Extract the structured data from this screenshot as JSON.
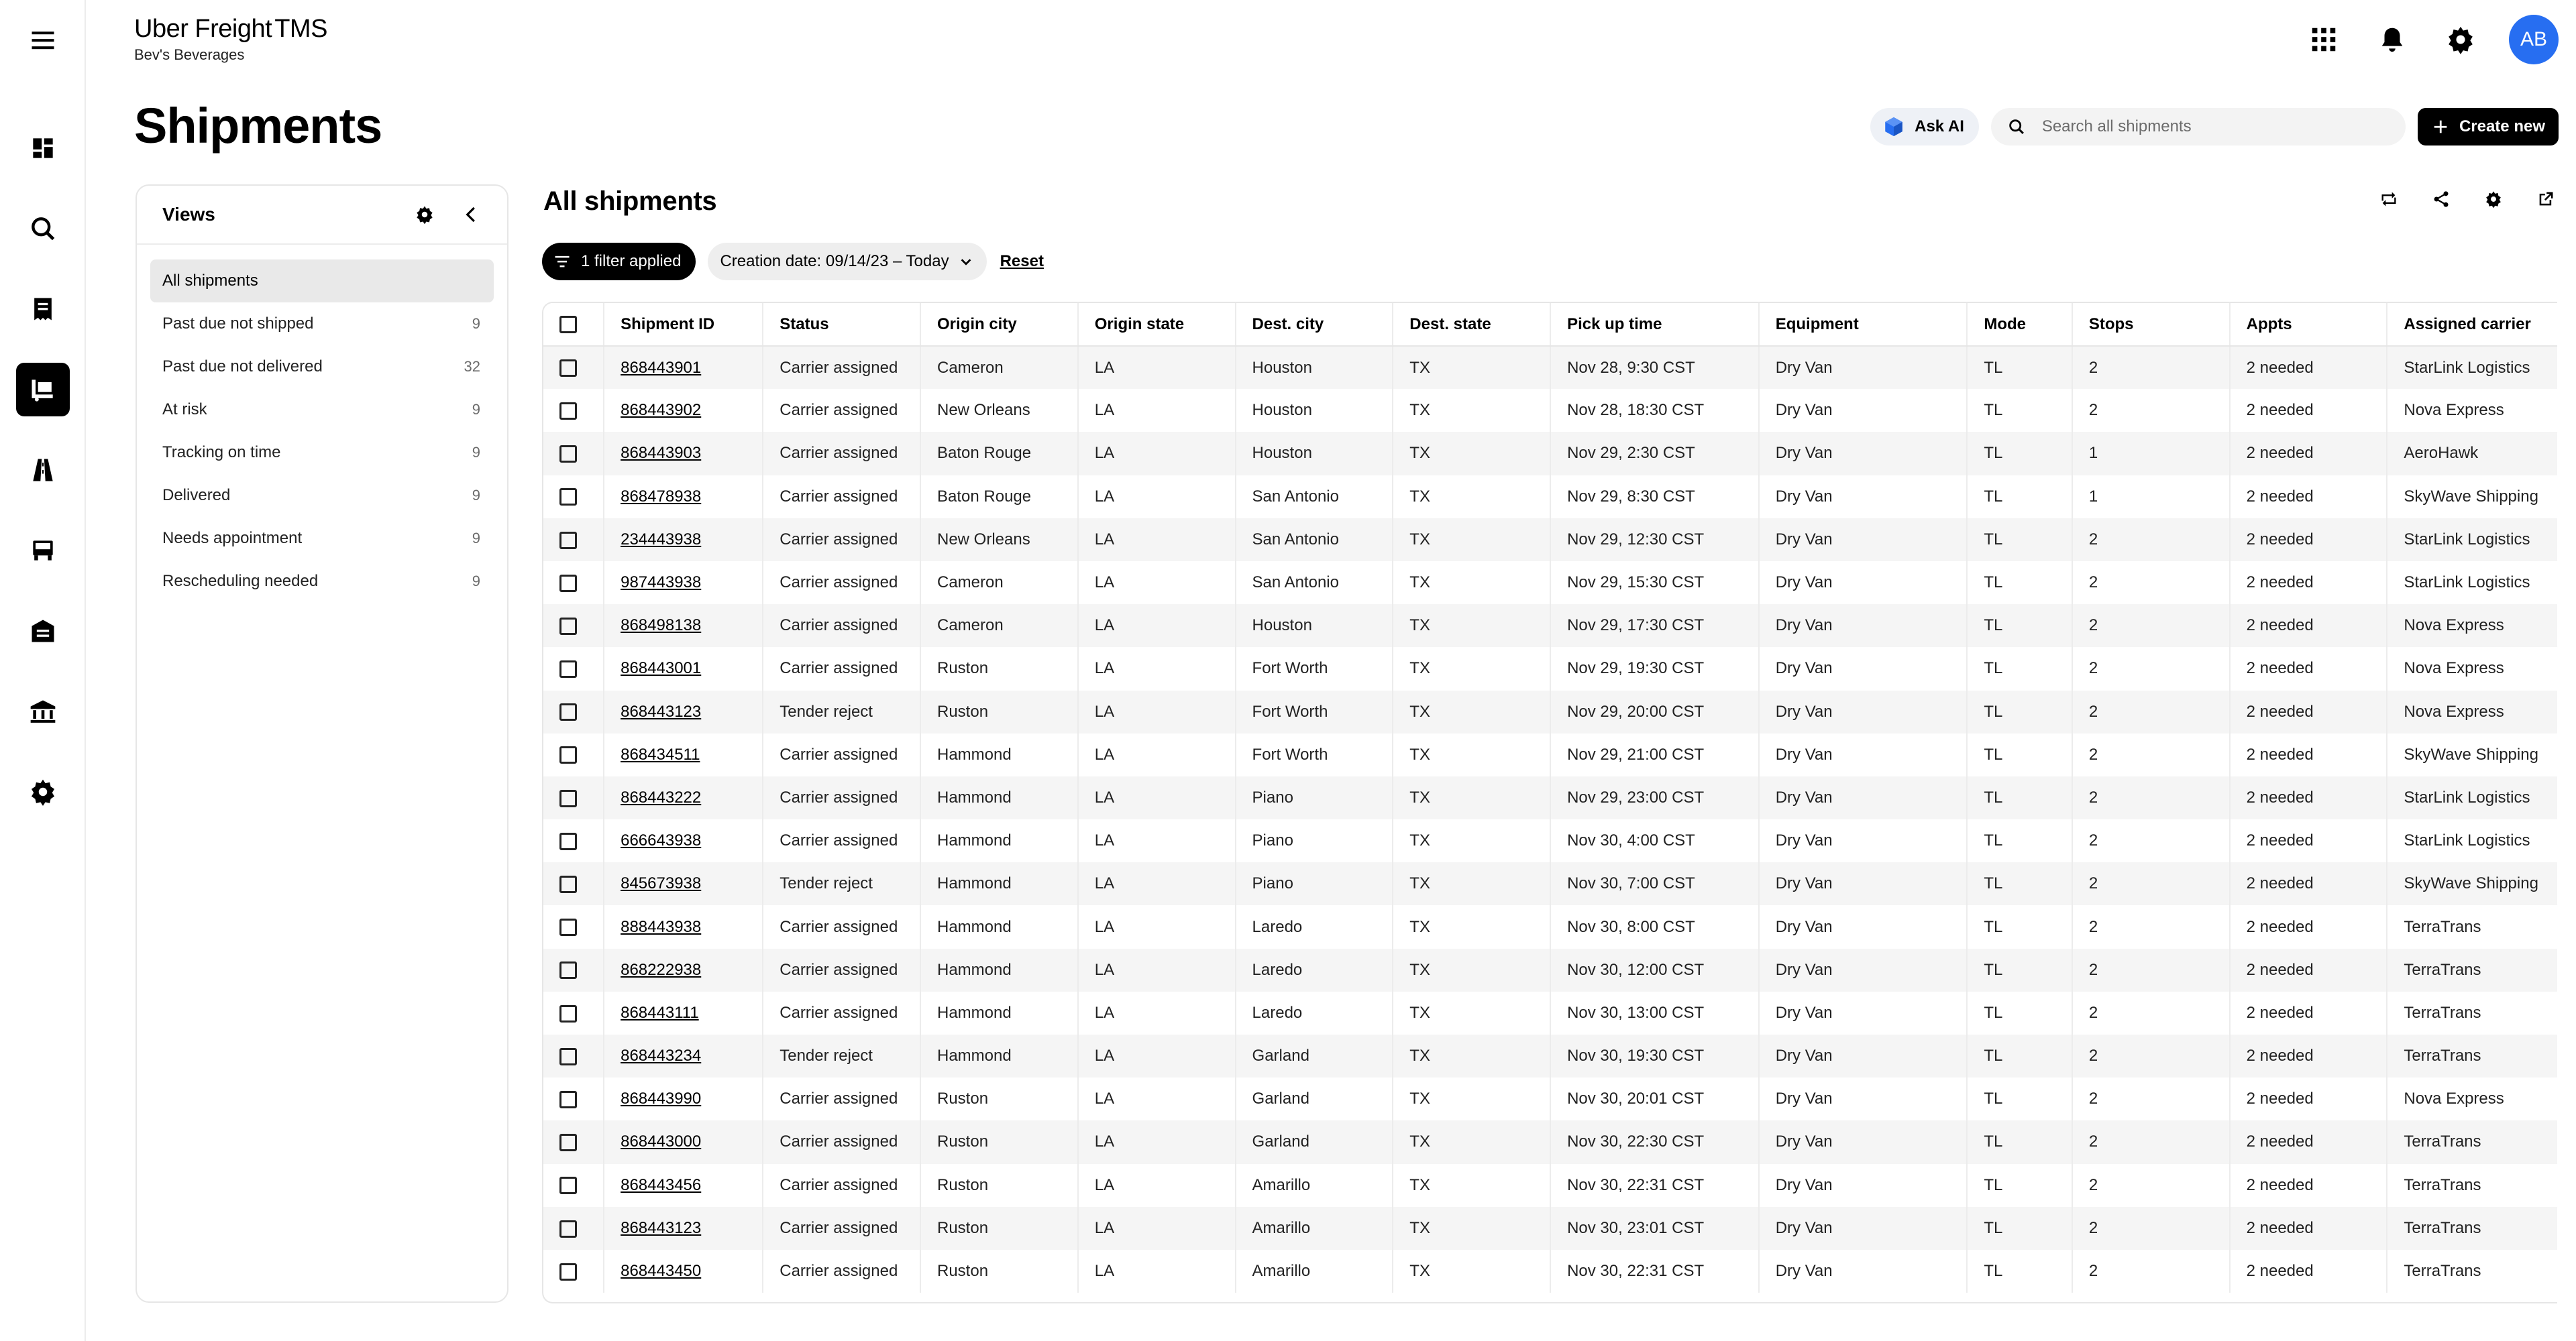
{
  "app": {
    "brand": "Uber Freight",
    "product": "TMS",
    "account": "Bev's Beverages",
    "avatar_initials": "AB"
  },
  "colors": {
    "accent": "#276ef1",
    "primary": "#000000",
    "row_alt": "#f5f5f5"
  },
  "nav": [
    "menu-icon",
    "dashboard-icon",
    "search-icon",
    "document-icon",
    "shipments-icon",
    "road-icon",
    "truck-icon",
    "warehouse-icon",
    "bank-icon",
    "settings-icon"
  ],
  "header": {
    "title": "Shipments",
    "ask_ai": "Ask AI",
    "search_placeholder": "Search all shipments",
    "create_new": "Create new"
  },
  "views": {
    "title": "Views",
    "items": [
      {
        "label": "All shipments",
        "count": ""
      },
      {
        "label": "Past due not shipped",
        "count": "9"
      },
      {
        "label": "Past due not delivered",
        "count": "32"
      },
      {
        "label": "At risk",
        "count": "9"
      },
      {
        "label": "Tracking on time",
        "count": "9"
      },
      {
        "label": "Delivered",
        "count": "9"
      },
      {
        "label": "Needs appointment",
        "count": "9"
      },
      {
        "label": "Rescheduling needed",
        "count": "9"
      }
    ]
  },
  "main": {
    "title": "All shipments",
    "filter_chip": "1 filter applied",
    "date_filter": "Creation date: 09/14/23 – Today",
    "reset": "Reset"
  },
  "table": {
    "columns": [
      "Shipment ID",
      "Status",
      "Origin city",
      "Origin state",
      "Dest. city",
      "Dest. state",
      "Pick up time",
      "Equipment",
      "Mode",
      "Stops",
      "Appts",
      "Assigned carrier"
    ],
    "rows": [
      [
        "868443901",
        "Carrier assigned",
        "Cameron",
        "LA",
        "Houston",
        "TX",
        "Nov 28, 9:30 CST",
        "Dry Van",
        "TL",
        "2",
        "2 needed",
        "StarLink Logistics"
      ],
      [
        "868443902",
        "Carrier assigned",
        "New Orleans",
        "LA",
        "Houston",
        "TX",
        "Nov 28, 18:30 CST",
        "Dry Van",
        "TL",
        "2",
        "2 needed",
        "Nova Express"
      ],
      [
        "868443903",
        "Carrier assigned",
        "Baton Rouge",
        "LA",
        "Houston",
        "TX",
        "Nov 29, 2:30 CST",
        "Dry Van",
        "TL",
        "1",
        "2 needed",
        "AeroHawk"
      ],
      [
        "868478938",
        "Carrier assigned",
        "Baton Rouge",
        "LA",
        "San Antonio",
        "TX",
        "Nov 29, 8:30 CST",
        "Dry Van",
        "TL",
        "1",
        "2 needed",
        "SkyWave Shipping"
      ],
      [
        "234443938",
        "Carrier assigned",
        "New Orleans",
        "LA",
        "San Antonio",
        "TX",
        "Nov 29, 12:30 CST",
        "Dry Van",
        "TL",
        "2",
        "2 needed",
        "StarLink Logistics"
      ],
      [
        "987443938",
        "Carrier assigned",
        "Cameron",
        "LA",
        "San Antonio",
        "TX",
        "Nov 29, 15:30 CST",
        "Dry Van",
        "TL",
        "2",
        "2 needed",
        "StarLink Logistics"
      ],
      [
        "868498138",
        "Carrier assigned",
        "Cameron",
        "LA",
        "Houston",
        "TX",
        "Nov 29, 17:30 CST",
        "Dry Van",
        "TL",
        "2",
        "2 needed",
        "Nova Express"
      ],
      [
        "868443001",
        "Carrier assigned",
        "Ruston",
        "LA",
        "Fort Worth",
        "TX",
        "Nov 29, 19:30 CST",
        "Dry Van",
        "TL",
        "2",
        "2 needed",
        "Nova Express"
      ],
      [
        "868443123",
        "Tender reject",
        "Ruston",
        "LA",
        "Fort Worth",
        "TX",
        "Nov 29, 20:00 CST",
        "Dry Van",
        "TL",
        "2",
        "2 needed",
        "Nova Express"
      ],
      [
        "868434511",
        "Carrier assigned",
        "Hammond",
        "LA",
        "Fort Worth",
        "TX",
        "Nov 29, 21:00 CST",
        "Dry Van",
        "TL",
        "2",
        "2 needed",
        "SkyWave Shipping"
      ],
      [
        "868443222",
        "Carrier assigned",
        "Hammond",
        "LA",
        "Piano",
        "TX",
        "Nov 29, 23:00 CST",
        "Dry Van",
        "TL",
        "2",
        "2 needed",
        "StarLink Logistics"
      ],
      [
        "666643938",
        "Carrier assigned",
        "Hammond",
        "LA",
        "Piano",
        "TX",
        "Nov 30, 4:00 CST",
        "Dry Van",
        "TL",
        "2",
        "2 needed",
        "StarLink Logistics"
      ],
      [
        "845673938",
        "Tender reject",
        "Hammond",
        "LA",
        "Piano",
        "TX",
        "Nov 30, 7:00 CST",
        "Dry Van",
        "TL",
        "2",
        "2 needed",
        "SkyWave Shipping"
      ],
      [
        "888443938",
        "Carrier assigned",
        "Hammond",
        "LA",
        "Laredo",
        "TX",
        "Nov 30, 8:00 CST",
        "Dry Van",
        "TL",
        "2",
        "2 needed",
        "TerraTrans"
      ],
      [
        "868222938",
        "Carrier assigned",
        "Hammond",
        "LA",
        "Laredo",
        "TX",
        "Nov 30, 12:00 CST",
        "Dry Van",
        "TL",
        "2",
        "2 needed",
        "TerraTrans"
      ],
      [
        "868443111",
        "Carrier assigned",
        "Hammond",
        "LA",
        "Laredo",
        "TX",
        "Nov 30, 13:00 CST",
        "Dry Van",
        "TL",
        "2",
        "2 needed",
        "TerraTrans"
      ],
      [
        "868443234",
        "Tender reject",
        "Hammond",
        "LA",
        "Garland",
        "TX",
        "Nov 30, 19:30 CST",
        "Dry Van",
        "TL",
        "2",
        "2 needed",
        "TerraTrans"
      ],
      [
        "868443990",
        "Carrier assigned",
        "Ruston",
        "LA",
        "Garland",
        "TX",
        "Nov 30, 20:01 CST",
        "Dry Van",
        "TL",
        "2",
        "2 needed",
        "Nova Express"
      ],
      [
        "868443000",
        "Carrier assigned",
        "Ruston",
        "LA",
        "Garland",
        "TX",
        "Nov 30, 22:30 CST",
        "Dry Van",
        "TL",
        "2",
        "2 needed",
        "TerraTrans"
      ],
      [
        "868443456",
        "Carrier assigned",
        "Ruston",
        "LA",
        "Amarillo",
        "TX",
        "Nov 30, 22:31 CST",
        "Dry Van",
        "TL",
        "2",
        "2 needed",
        "TerraTrans"
      ],
      [
        "868443123",
        "Carrier assigned",
        "Ruston",
        "LA",
        "Amarillo",
        "TX",
        "Nov 30, 23:01 CST",
        "Dry Van",
        "TL",
        "2",
        "2 needed",
        "TerraTrans"
      ],
      [
        "868443450",
        "Carrier assigned",
        "Ruston",
        "LA",
        "Amarillo",
        "TX",
        "Nov 30, 22:31 CST",
        "Dry Van",
        "TL",
        "2",
        "2 needed",
        "TerraTrans"
      ]
    ]
  }
}
